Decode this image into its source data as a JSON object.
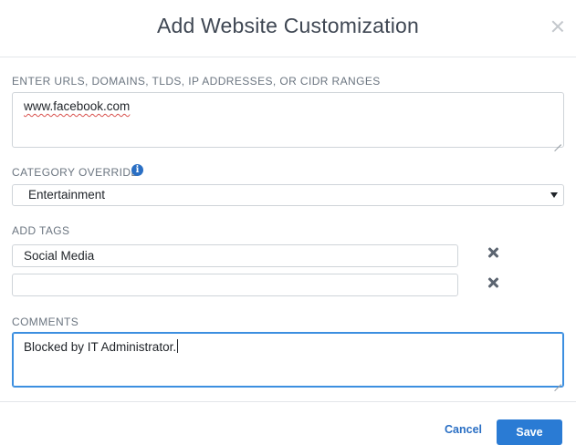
{
  "dialog": {
    "title": "Add Website Customization"
  },
  "urls": {
    "label": "ENTER URLS, DOMAINS, TLDS, IP ADDRESSES, OR CIDR RANGES",
    "value": "www.facebook.com"
  },
  "category": {
    "label": "CATEGORY OVERRIDE",
    "info_icon": "info-icon",
    "selected": "Entertainment"
  },
  "tags": {
    "label": "ADD TAGS",
    "items": [
      {
        "value": "Social Media"
      },
      {
        "value": ""
      }
    ],
    "remove_icon": "remove-icon"
  },
  "comments": {
    "label": "COMMENTS",
    "value": "Blocked by IT Administrator."
  },
  "footer": {
    "cancel_label": "Cancel",
    "save_label": "Save"
  },
  "colors": {
    "accent": "#2a7bd4",
    "focus_border": "#3c8fe0"
  }
}
